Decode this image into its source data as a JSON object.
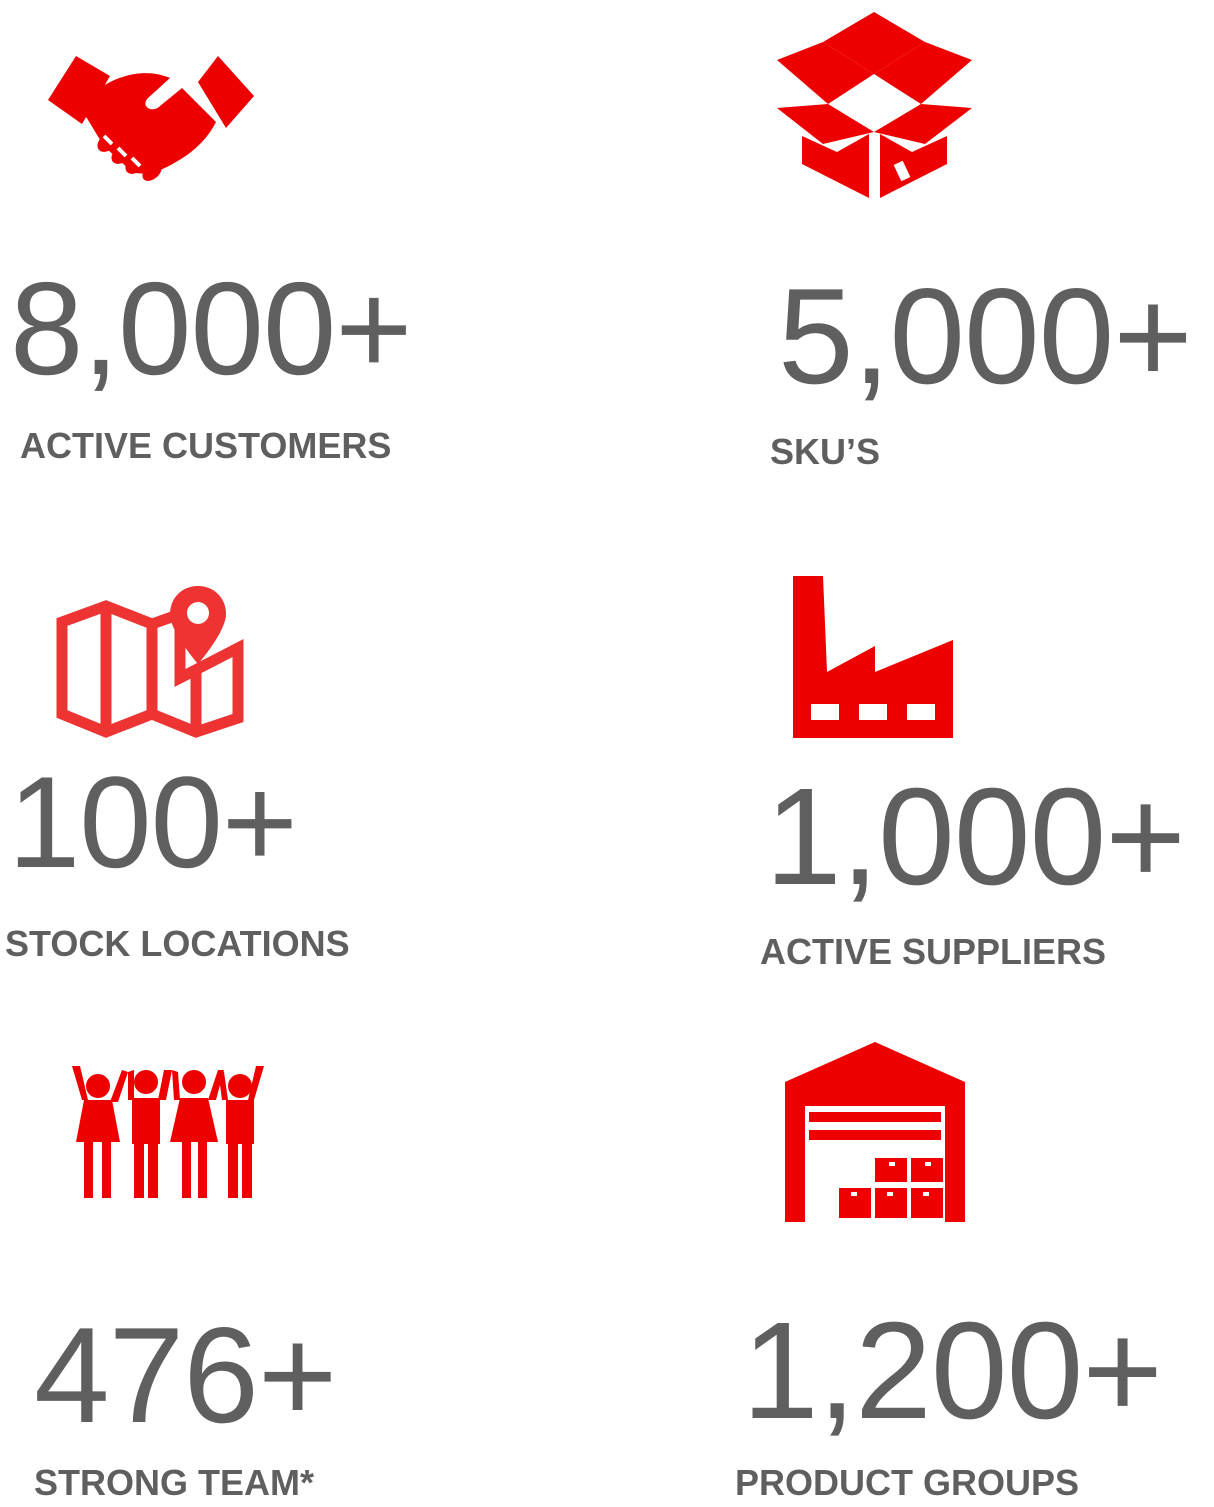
{
  "accent_color": "#ee0000",
  "stats": [
    {
      "icon": "handshake-icon",
      "value": "8,000+",
      "label": "ACTIVE CUSTOMERS"
    },
    {
      "icon": "open-box-icon",
      "value": "5,000+",
      "label": "SKU’S"
    },
    {
      "icon": "map-pin-icon",
      "value": "100+",
      "label": "STOCK LOCATIONS"
    },
    {
      "icon": "factory-icon",
      "value": "1,000+",
      "label": "ACTIVE SUPPLIERS"
    },
    {
      "icon": "team-people-icon",
      "value": "476+",
      "label": "STRONG TEAM*"
    },
    {
      "icon": "warehouse-icon",
      "value": "1,200+",
      "label": "PRODUCT GROUPS"
    }
  ]
}
